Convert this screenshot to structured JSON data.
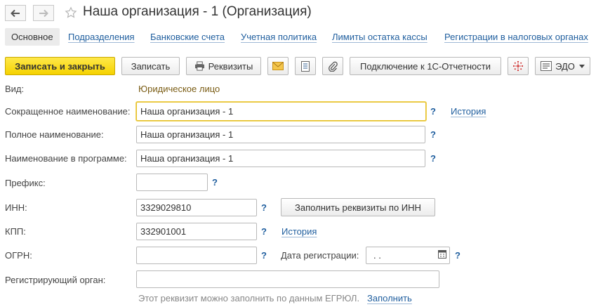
{
  "window": {
    "title": "Наша организация - 1 (Организация)",
    "icons": {
      "back": "arrow-left-icon",
      "forward": "arrow-right-icon",
      "favorite": "star-icon"
    }
  },
  "tabs": [
    {
      "label": "Основное",
      "active": true
    },
    {
      "label": "Подразделения"
    },
    {
      "label": "Банковские счета"
    },
    {
      "label": "Учетная политика"
    },
    {
      "label": "Лимиты остатка кассы"
    },
    {
      "label": "Регистрации в налоговых органах"
    }
  ],
  "toolbar": {
    "save_close": "Записать и закрыть",
    "save": "Записать",
    "requisites": "Реквизиты",
    "connect_1c": "Подключение к 1С-Отчетности",
    "edo": "ЭДО",
    "icons": {
      "requisites": "printer-icon",
      "mail": "envelope-icon",
      "document": "document-list-icon",
      "attach": "paperclip-icon",
      "network": "network-dots-icon",
      "edo": "edo-icon",
      "edo_dropdown": "chevron-down-icon"
    },
    "colors": {
      "primary": "#f5d200",
      "mail": "#e5a21a",
      "network": "#d03030"
    }
  },
  "form": {
    "kind_label": "Вид:",
    "kind_value": "Юридическое лицо",
    "short_name_label": "Сокращенное наименование:",
    "short_name_value": "Наша организация - 1",
    "full_name_label": "Полное наименование:",
    "full_name_value": "Наша организация - 1",
    "program_name_label": "Наименование в программе:",
    "program_name_value": "Наша организация - 1",
    "prefix_label": "Префикс:",
    "prefix_value": "",
    "inn_label": "ИНН:",
    "inn_value": "3329029810",
    "fill_by_inn": "Заполнить реквизиты по ИНН",
    "kpp_label": "КПП:",
    "kpp_value": "332901001",
    "ogrn_label": "ОГРН:",
    "ogrn_value": "",
    "reg_date_label": "Дата регистрации:",
    "reg_date_value": " .  .",
    "reg_organ_label": "Регистрирующий орган:",
    "reg_organ_value": "",
    "hint_text": "Этот реквизит можно заполнить по данным ЕГРЮЛ.",
    "hint_link": "Заполнить",
    "history_link": "История",
    "help_mark": "?",
    "calendar_icon": "calendar-icon"
  }
}
